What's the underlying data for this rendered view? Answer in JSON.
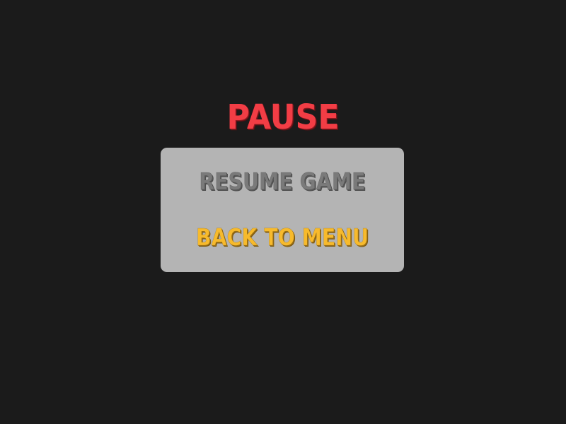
{
  "title": "PAUSE",
  "menu": {
    "options": [
      {
        "label": "RESUME GAME",
        "state": "normal"
      },
      {
        "label": "BACK TO MENU",
        "state": "highlighted"
      }
    ]
  },
  "colors": {
    "background": "#1b1b1b",
    "title": "#f23d45",
    "panel": "#b4b4b4",
    "option_normal": "#7a7a7a",
    "option_highlighted": "#f7ba2c"
  }
}
